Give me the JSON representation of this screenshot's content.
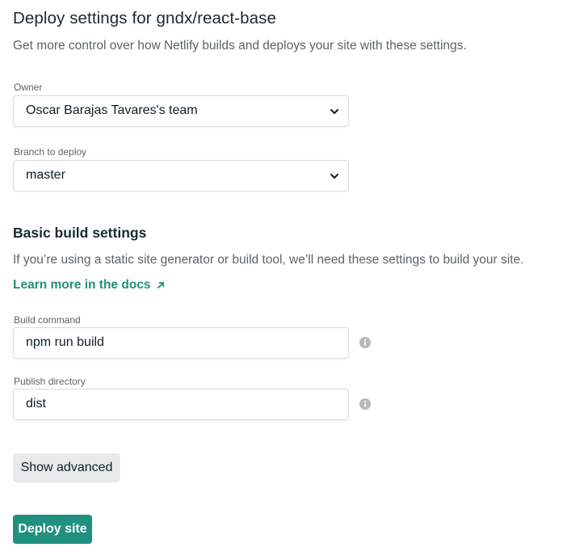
{
  "header": {
    "title": "Deploy settings for gndx/react-base",
    "subtitle": "Get more control over how Netlify builds and deploys your site with these settings."
  },
  "owner": {
    "label": "Owner",
    "selected": "Oscar Barajas Tavares's team"
  },
  "branch": {
    "label": "Branch to deploy",
    "selected": "master"
  },
  "build_settings": {
    "title": "Basic build settings",
    "description": "If you’re using a static site generator or build tool, we’ll need these settings to build your site.",
    "docs_link": "Learn more in the docs",
    "build_command": {
      "label": "Build command",
      "value": "npm run build"
    },
    "publish_directory": {
      "label": "Publish directory",
      "value": "dist"
    }
  },
  "actions": {
    "show_advanced": "Show advanced",
    "deploy": "Deploy site"
  },
  "colors": {
    "accent": "#20917e",
    "text": "#0e1e25",
    "muted": "#5a6469",
    "border": "#d8dadc",
    "secondary_button": "#e9ebeb"
  },
  "icons": [
    "chevron-down-icon",
    "arrow-up-right-icon",
    "info-icon"
  ]
}
